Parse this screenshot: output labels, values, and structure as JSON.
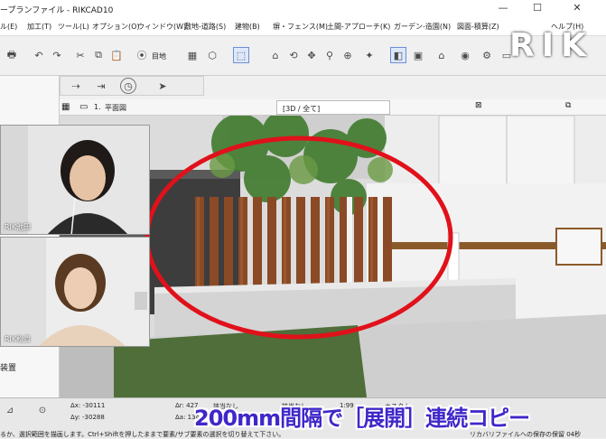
{
  "window": {
    "title": "ープランファイル - RIKCAD10",
    "minimize": "—",
    "maximize": "☐",
    "close": "✕"
  },
  "menu": [
    "ル(E)",
    "加工(T)",
    "ツール(L)",
    "オプション(O)",
    "ウィンドウ(W)",
    "敷地-道路(S)",
    "建物(B)",
    "塀・フェンス(M)",
    "土間-アプローチ(K)",
    "ガーデン-造園(N)",
    "図面-積算(Z)",
    "ヘルプ(H)"
  ],
  "toolbar": {
    "view_label": "目地",
    "dropdown_arrow": "▾"
  },
  "tabs": {
    "plan_index": "1.",
    "plan_label": "平面図",
    "view3d_label": "[3D / 全て]"
  },
  "videos": [
    {
      "name": "RIK池田"
    },
    {
      "name": "RIK松貴"
    }
  ],
  "status": {
    "hint": "るか、選択範囲を描画します。Ctrl+Shiftを押したままで要素/サブ要素の選択を切り替えて下さい。",
    "dx_label": "Δx: -30111",
    "dy_label": "Δy: -30288",
    "dist_label": "Δr: 427",
    "angle_label": "Δa: 134",
    "select_none": "該当なし",
    "select_none2": "該当なし",
    "scale": "1:99",
    "custom": "カスタム",
    "save_note": "リカバリファイルへの保存の保留 04秒",
    "left_text": "装置"
  },
  "caption": "200mm間隔で［展開］連続コピー",
  "logo": "RIK",
  "colors": {
    "caption": "#3f27c9",
    "highlight": "#e0111a",
    "wood": "#8a4a25"
  }
}
